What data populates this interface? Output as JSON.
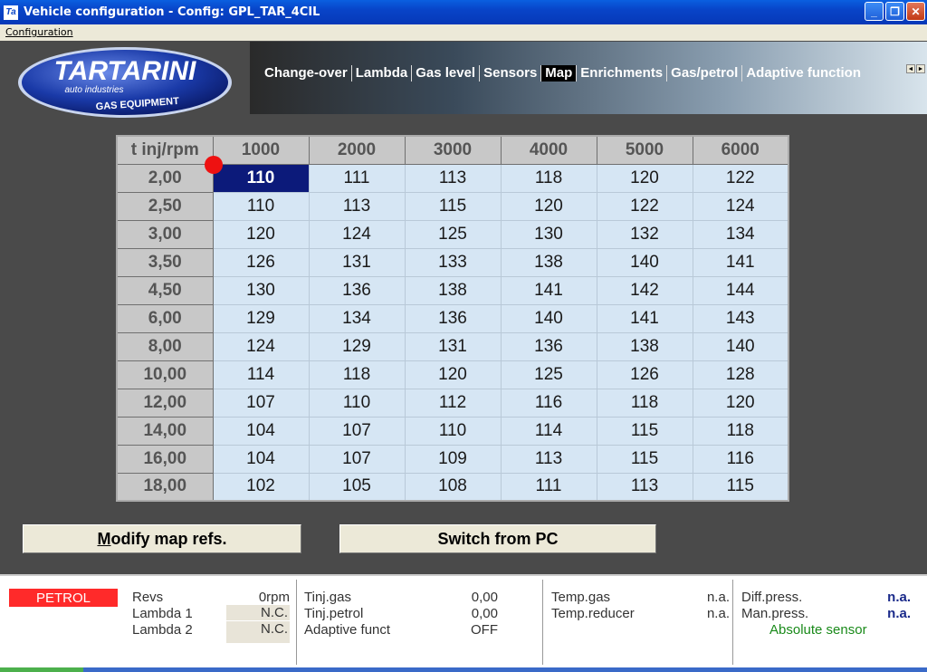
{
  "window": {
    "title": "Vehicle configuration - Config: GPL_TAR_4CIL",
    "icon_letters": "Ta",
    "minimize": "_",
    "maximize": "❐",
    "close": "✕"
  },
  "menu": {
    "items": [
      {
        "label": "Configuration"
      }
    ]
  },
  "logo": {
    "brand": "TARTARINI",
    "tagline": "auto industries",
    "sub": "GAS EQUIPMENT"
  },
  "tabs": {
    "items": [
      "Change-over",
      "Lambda",
      "Gas level",
      "Sensors",
      "Map",
      "Enrichments",
      "Gas/petrol",
      "Adaptive function"
    ],
    "active": "Map",
    "scroll_left": "◄",
    "scroll_right": "►"
  },
  "map": {
    "corner": "t inj/rpm",
    "rpm": [
      "1000",
      "2000",
      "3000",
      "4000",
      "5000",
      "6000"
    ],
    "rows": [
      {
        "tinj": "2,00",
        "values": [
          "110",
          "111",
          "113",
          "118",
          "120",
          "122"
        ]
      },
      {
        "tinj": "2,50",
        "values": [
          "110",
          "113",
          "115",
          "120",
          "122",
          "124"
        ]
      },
      {
        "tinj": "3,00",
        "values": [
          "120",
          "124",
          "125",
          "130",
          "132",
          "134"
        ]
      },
      {
        "tinj": "3,50",
        "values": [
          "126",
          "131",
          "133",
          "138",
          "140",
          "141"
        ]
      },
      {
        "tinj": "4,50",
        "values": [
          "130",
          "136",
          "138",
          "141",
          "142",
          "144"
        ]
      },
      {
        "tinj": "6,00",
        "values": [
          "129",
          "134",
          "136",
          "140",
          "141",
          "143"
        ]
      },
      {
        "tinj": "8,00",
        "values": [
          "124",
          "129",
          "131",
          "136",
          "138",
          "140"
        ]
      },
      {
        "tinj": "10,00",
        "values": [
          "114",
          "118",
          "120",
          "125",
          "126",
          "128"
        ]
      },
      {
        "tinj": "12,00",
        "values": [
          "107",
          "110",
          "112",
          "116",
          "118",
          "120"
        ]
      },
      {
        "tinj": "14,00",
        "values": [
          "104",
          "107",
          "110",
          "114",
          "115",
          "118"
        ]
      },
      {
        "tinj": "16,00",
        "values": [
          "104",
          "107",
          "109",
          "113",
          "115",
          "116"
        ]
      },
      {
        "tinj": "18,00",
        "values": [
          "102",
          "105",
          "108",
          "111",
          "113",
          "115"
        ]
      }
    ],
    "selected_cell": {
      "row": 0,
      "col": 0
    }
  },
  "buttons": {
    "modify_first": "M",
    "modify_rest": "odify map refs.",
    "switch": "Switch from PC"
  },
  "status": {
    "fuel_mode": "PETROL",
    "revs_label": "Revs",
    "revs_value": "0rpm",
    "lambda1_label": "Lambda 1",
    "lambda1_value": "N.C.",
    "lambda2_label": "Lambda 2",
    "lambda2_value": "N.C.",
    "tinj_gas_label": "Tinj.gas",
    "tinj_gas_value": "0,00",
    "tinj_petrol_label": "Tinj.petrol",
    "tinj_petrol_value": "0,00",
    "adaptive_label": "Adaptive funct",
    "adaptive_value": "OFF",
    "temp_gas_label": "Temp.gas",
    "temp_gas_value": "n.a.",
    "temp_reducer_label": "Temp.reducer",
    "temp_reducer_value": "n.a.",
    "diff_press_label": "Diff.press.",
    "diff_press_value": "n.a.",
    "man_press_label": "Man.press.",
    "man_press_value": "n.a.",
    "sensor_type": "Absolute sensor"
  },
  "colors": {
    "petrol": "#ff2a2a",
    "selected": "#0c1a7a",
    "cell": "#d6e6f4",
    "accent_green": "#1a8a1a"
  }
}
